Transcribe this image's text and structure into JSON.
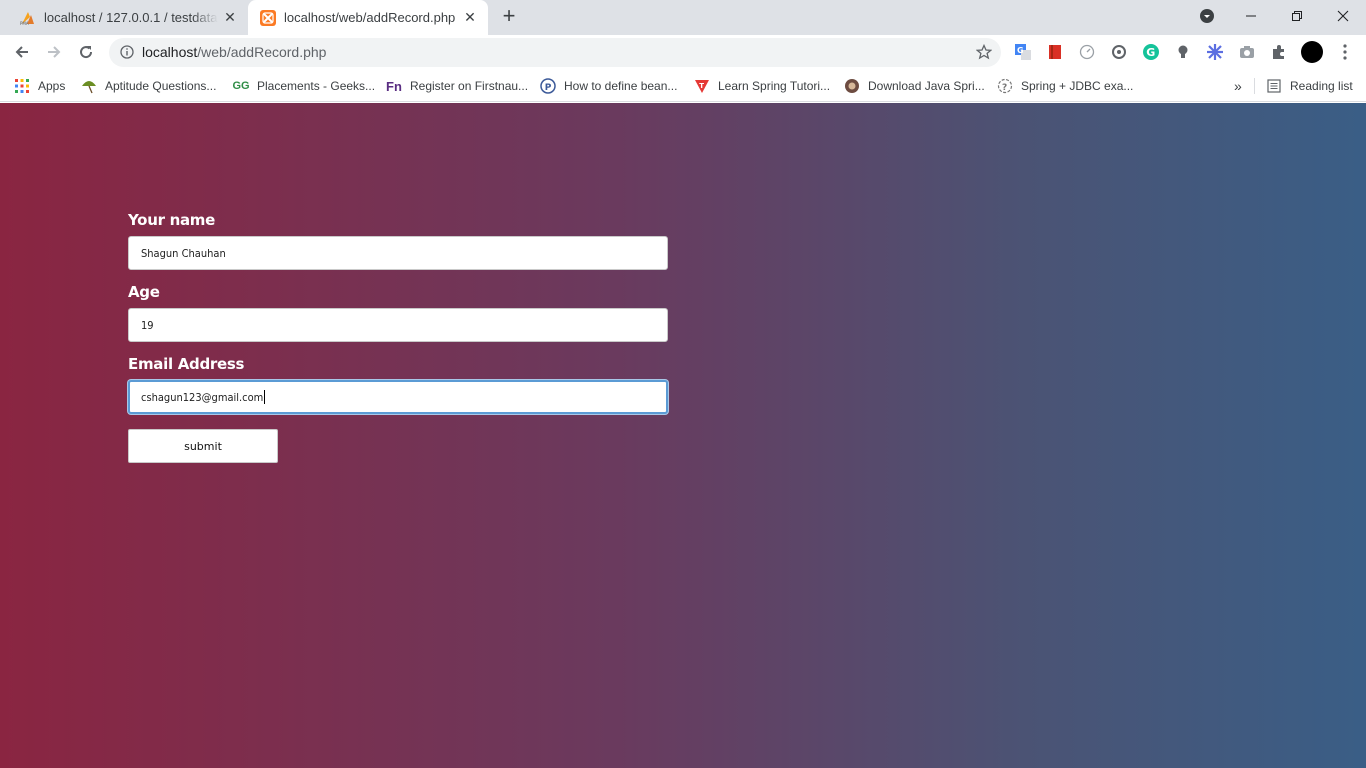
{
  "browser": {
    "tabs": [
      {
        "title": "localhost / 127.0.0.1 / testdatabase",
        "favicon": "phpmyadmin-icon",
        "active": false
      },
      {
        "title": "localhost/web/addRecord.php",
        "favicon": "xampp-icon",
        "active": true
      }
    ],
    "address": {
      "host": "localhost",
      "path": "/web/addRecord.php"
    },
    "bookmarks": [
      {
        "label": "Apps",
        "icon": "apps-grid-icon"
      },
      {
        "label": "Aptitude Questions...",
        "icon": "umbrella-icon"
      },
      {
        "label": "Placements - Geeks...",
        "icon": "gfg-icon"
      },
      {
        "label": "Register on Firstnau...",
        "icon": "fn-icon"
      },
      {
        "label": "How to define bean...",
        "icon": "p-icon"
      },
      {
        "label": "Learn Spring Tutori...",
        "icon": "t-icon"
      },
      {
        "label": "Download Java Spri...",
        "icon": "coffee-icon"
      },
      {
        "label": "Spring + JDBC exa...",
        "icon": "question-icon"
      }
    ],
    "reading_list": "Reading list"
  },
  "form": {
    "name_label": "Your name",
    "name_value": "Shagun Chauhan",
    "age_label": "Age",
    "age_value": "19",
    "email_label": "Email Address",
    "email_value": "cshagun123@gmail.com",
    "submit_label": "submit"
  },
  "colors": {
    "gradient_left": "#8a2541",
    "gradient_right": "#3a5e86",
    "focus_ring": "#5b9bd5"
  }
}
